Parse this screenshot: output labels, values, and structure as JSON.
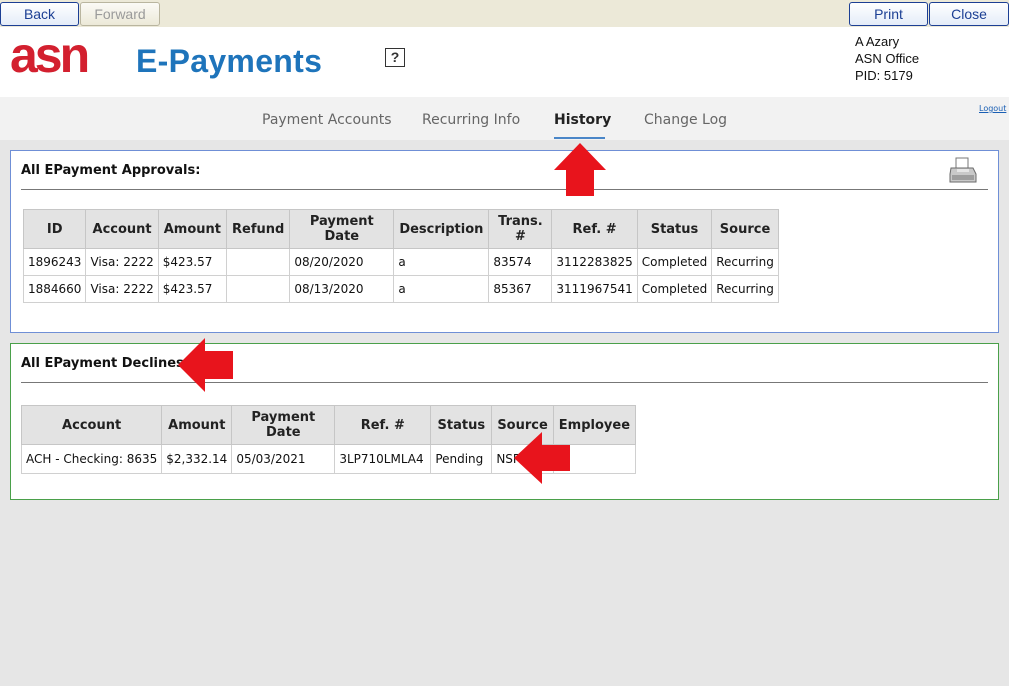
{
  "toolbar": {
    "back_label": "Back",
    "forward_label": "Forward",
    "print_label": "Print",
    "close_label": "Close"
  },
  "header": {
    "logo_asn": "asn",
    "logo_text": "E-Payments",
    "help_label": "?",
    "user": {
      "name": "A Azary",
      "office": "ASN Office",
      "pid": "PID: 5179"
    },
    "logout_label": "Logout"
  },
  "nav": {
    "tabs": [
      {
        "label": "Payment Accounts",
        "active": false
      },
      {
        "label": "Recurring Info",
        "active": false
      },
      {
        "label": "History",
        "active": true
      },
      {
        "label": "Change Log",
        "active": false
      }
    ]
  },
  "approvals": {
    "title": "All EPayment Approvals:",
    "columns": [
      "ID",
      "Account",
      "Amount",
      "Refund",
      "Payment Date",
      "Description",
      "Trans. #",
      "Ref. #",
      "Status",
      "Source"
    ],
    "rows": [
      [
        "1896243",
        "Visa: 2222",
        "$423.57",
        "",
        "08/20/2020",
        "a",
        "83574",
        "3112283825",
        "Completed",
        "Recurring"
      ],
      [
        "1884660",
        "Visa: 2222",
        "$423.57",
        "",
        "08/13/2020",
        "a",
        "85367",
        "3111967541",
        "Completed",
        "Recurring"
      ]
    ]
  },
  "declines": {
    "title": "All EPayment Declines:",
    "columns": [
      "Account",
      "Amount",
      "Payment Date",
      "Ref. #",
      "Status",
      "Source",
      "Employee"
    ],
    "rows": [
      [
        "ACH - Checking: 8635",
        "$2,332.14",
        "05/03/2021",
        "3LP710LMLA4",
        "Pending",
        "NSF",
        ""
      ]
    ]
  },
  "icons": {
    "printer": "printer-icon",
    "help": "help-icon",
    "arrow": "red-arrow-icon"
  },
  "colors": {
    "logo_red": "#d3202f",
    "logo_blue": "#1e74bb",
    "arrow_red": "#e8141c",
    "approvals_border": "#6f8fd6",
    "declines_border": "#4aa04a"
  }
}
